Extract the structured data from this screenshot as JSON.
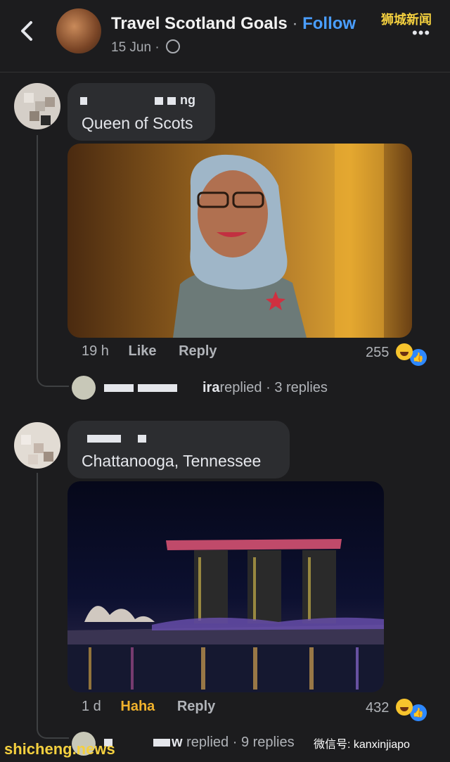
{
  "header": {
    "back_icon": "chevron-left-icon",
    "page_name": "Travel Scotland Goals",
    "separator": "·",
    "follow_label": "Follow",
    "date": "15 Jun",
    "meta_separator": "·",
    "privacy_icon": "globe-icon",
    "watermark": "狮城新闻",
    "more_label": "•••"
  },
  "comments": [
    {
      "author_visible": "ng",
      "text": "Queen of Scots",
      "time": "19 h",
      "like_label": "Like",
      "reply_label": "Reply",
      "reaction_count": "255",
      "reply_summary": {
        "replier_visible": "ira",
        "replied_label": "replied",
        "separator": "·",
        "count_label": "3 replies"
      }
    },
    {
      "author_visible": "",
      "text": "Chattanooga, Tennessee",
      "time": "1 d",
      "like_label": "Haha",
      "reply_label": "Reply",
      "reaction_count": "432",
      "reply_summary": {
        "replier_visible": "w",
        "replied_label": "replied",
        "separator": "·",
        "count_label": "9 replies"
      }
    }
  ],
  "watermarks": {
    "bottom_left": "shicheng.news",
    "bottom_right": "微信号: kanxinjiapo"
  },
  "colors": {
    "background": "#1c1c1e",
    "bubble": "#2c2d30",
    "follow": "#4a9eff",
    "haha": "#f1b22c",
    "watermark": "#f4d03f"
  }
}
